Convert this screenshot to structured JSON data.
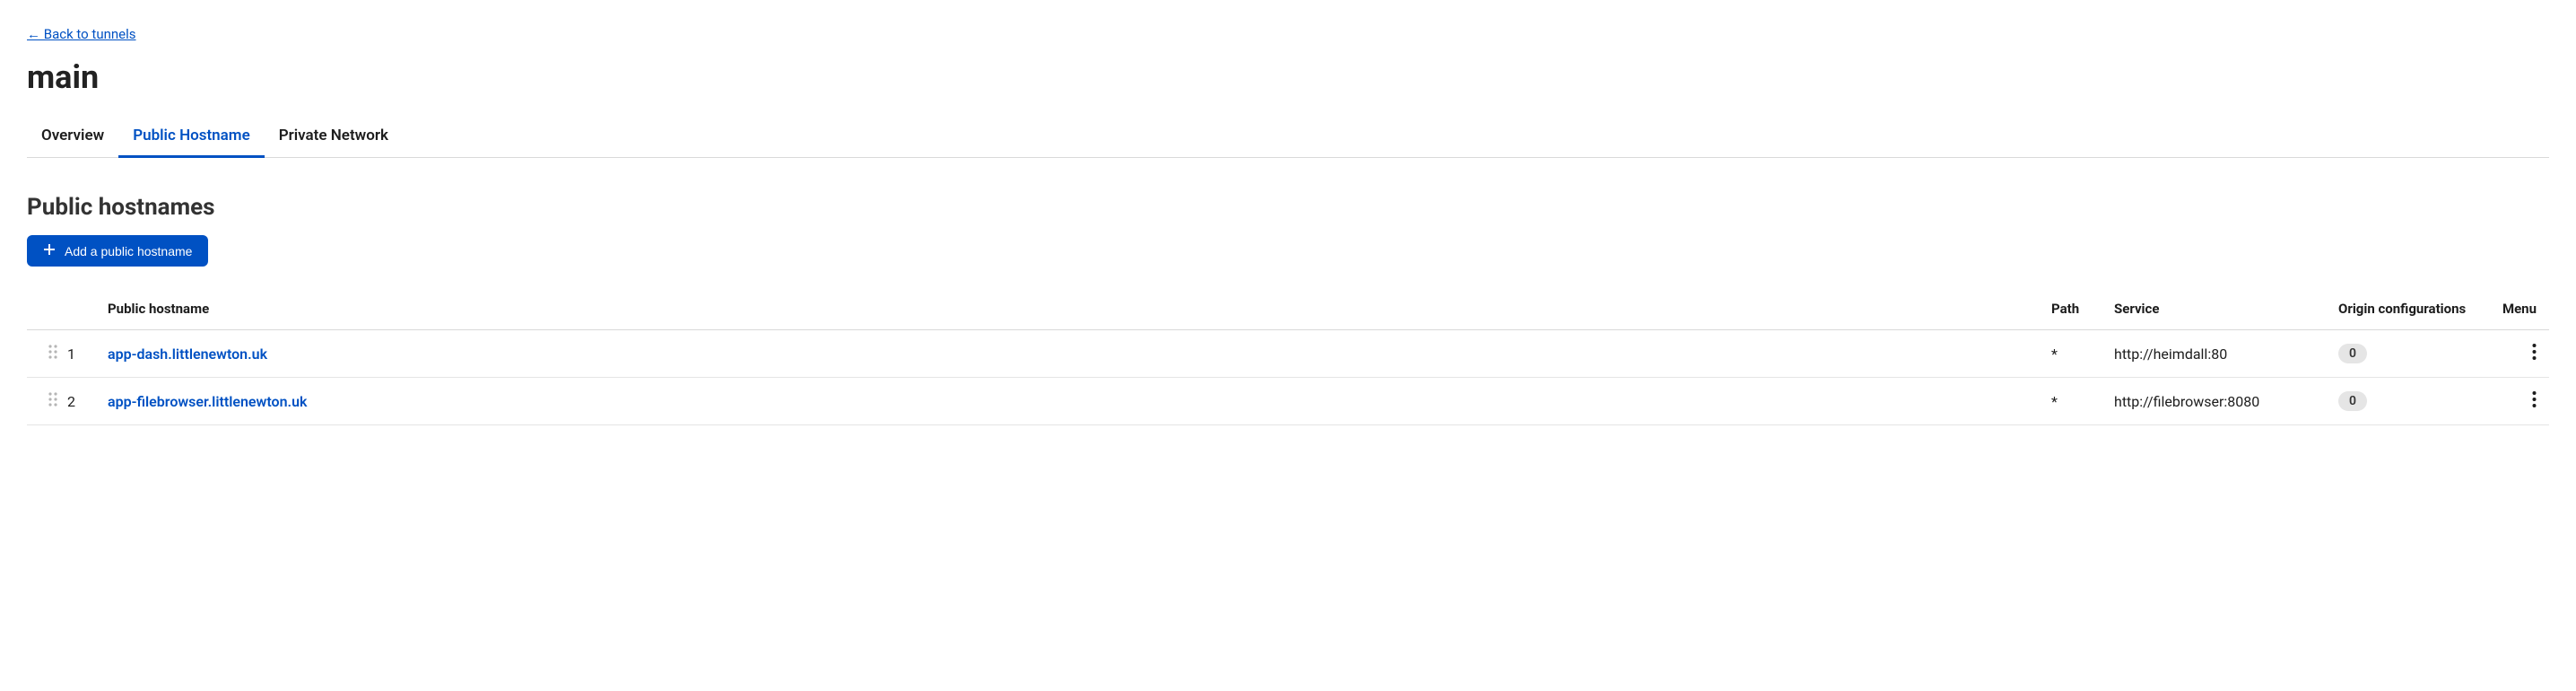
{
  "back_link": "← Back to tunnels",
  "page_title": "main",
  "tabs": [
    {
      "label": "Overview",
      "active": false
    },
    {
      "label": "Public Hostname",
      "active": true
    },
    {
      "label": "Private Network",
      "active": false
    }
  ],
  "section_title": "Public hostnames",
  "add_button_label": "Add a public hostname",
  "columns": {
    "hostname": "Public hostname",
    "path": "Path",
    "service": "Service",
    "config": "Origin configurations",
    "menu": "Menu"
  },
  "rows": [
    {
      "index": "1",
      "hostname": "app-dash.littlenewton.uk",
      "path": "*",
      "service": "http://heimdall:80",
      "config": "0"
    },
    {
      "index": "2",
      "hostname": "app-filebrowser.littlenewton.uk",
      "path": "*",
      "service": "http://filebrowser:8080",
      "config": "0"
    }
  ]
}
